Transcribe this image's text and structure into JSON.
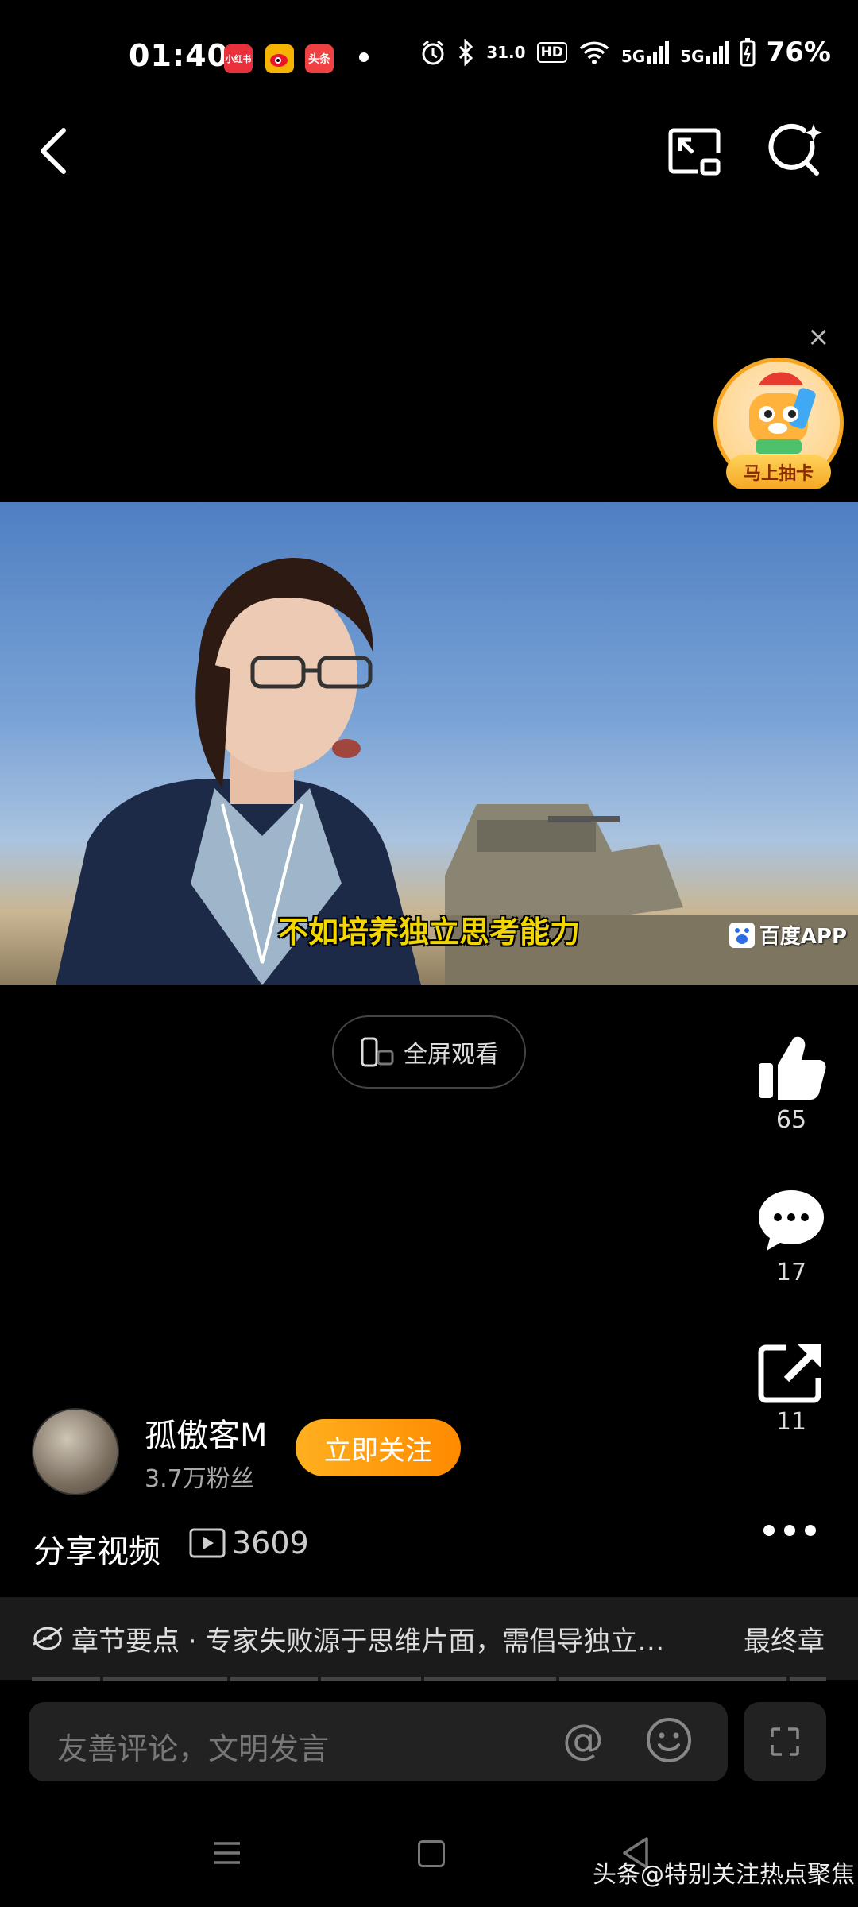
{
  "status_bar": {
    "time": "01:40",
    "apps": [
      "小红书",
      "微博",
      "头条"
    ],
    "speed": "31.0",
    "hd": "HD",
    "net1": "5G",
    "net2": "5G",
    "battery": "76%"
  },
  "promo": {
    "label": "马上抽卡",
    "close": "×"
  },
  "video": {
    "subtitle": "不如培养独立思考能力",
    "watermark": "百度APP"
  },
  "fullscreen_label": "全屏观看",
  "actions": {
    "like_count": "65",
    "comment_count": "17",
    "share_count": "11"
  },
  "author": {
    "name": "孤傲客M",
    "fans": "3.7万粉丝",
    "follow_label": "立即关注"
  },
  "post": {
    "share_label": "分享视频",
    "views": "3609"
  },
  "chapter": {
    "text": "章节要点 · 专家失败源于思维片面，需倡导独立…",
    "last_label": "最终章"
  },
  "comment": {
    "placeholder": "友善评论，文明发言",
    "at": "@"
  },
  "watermark": "头条@特别关注热点聚焦"
}
